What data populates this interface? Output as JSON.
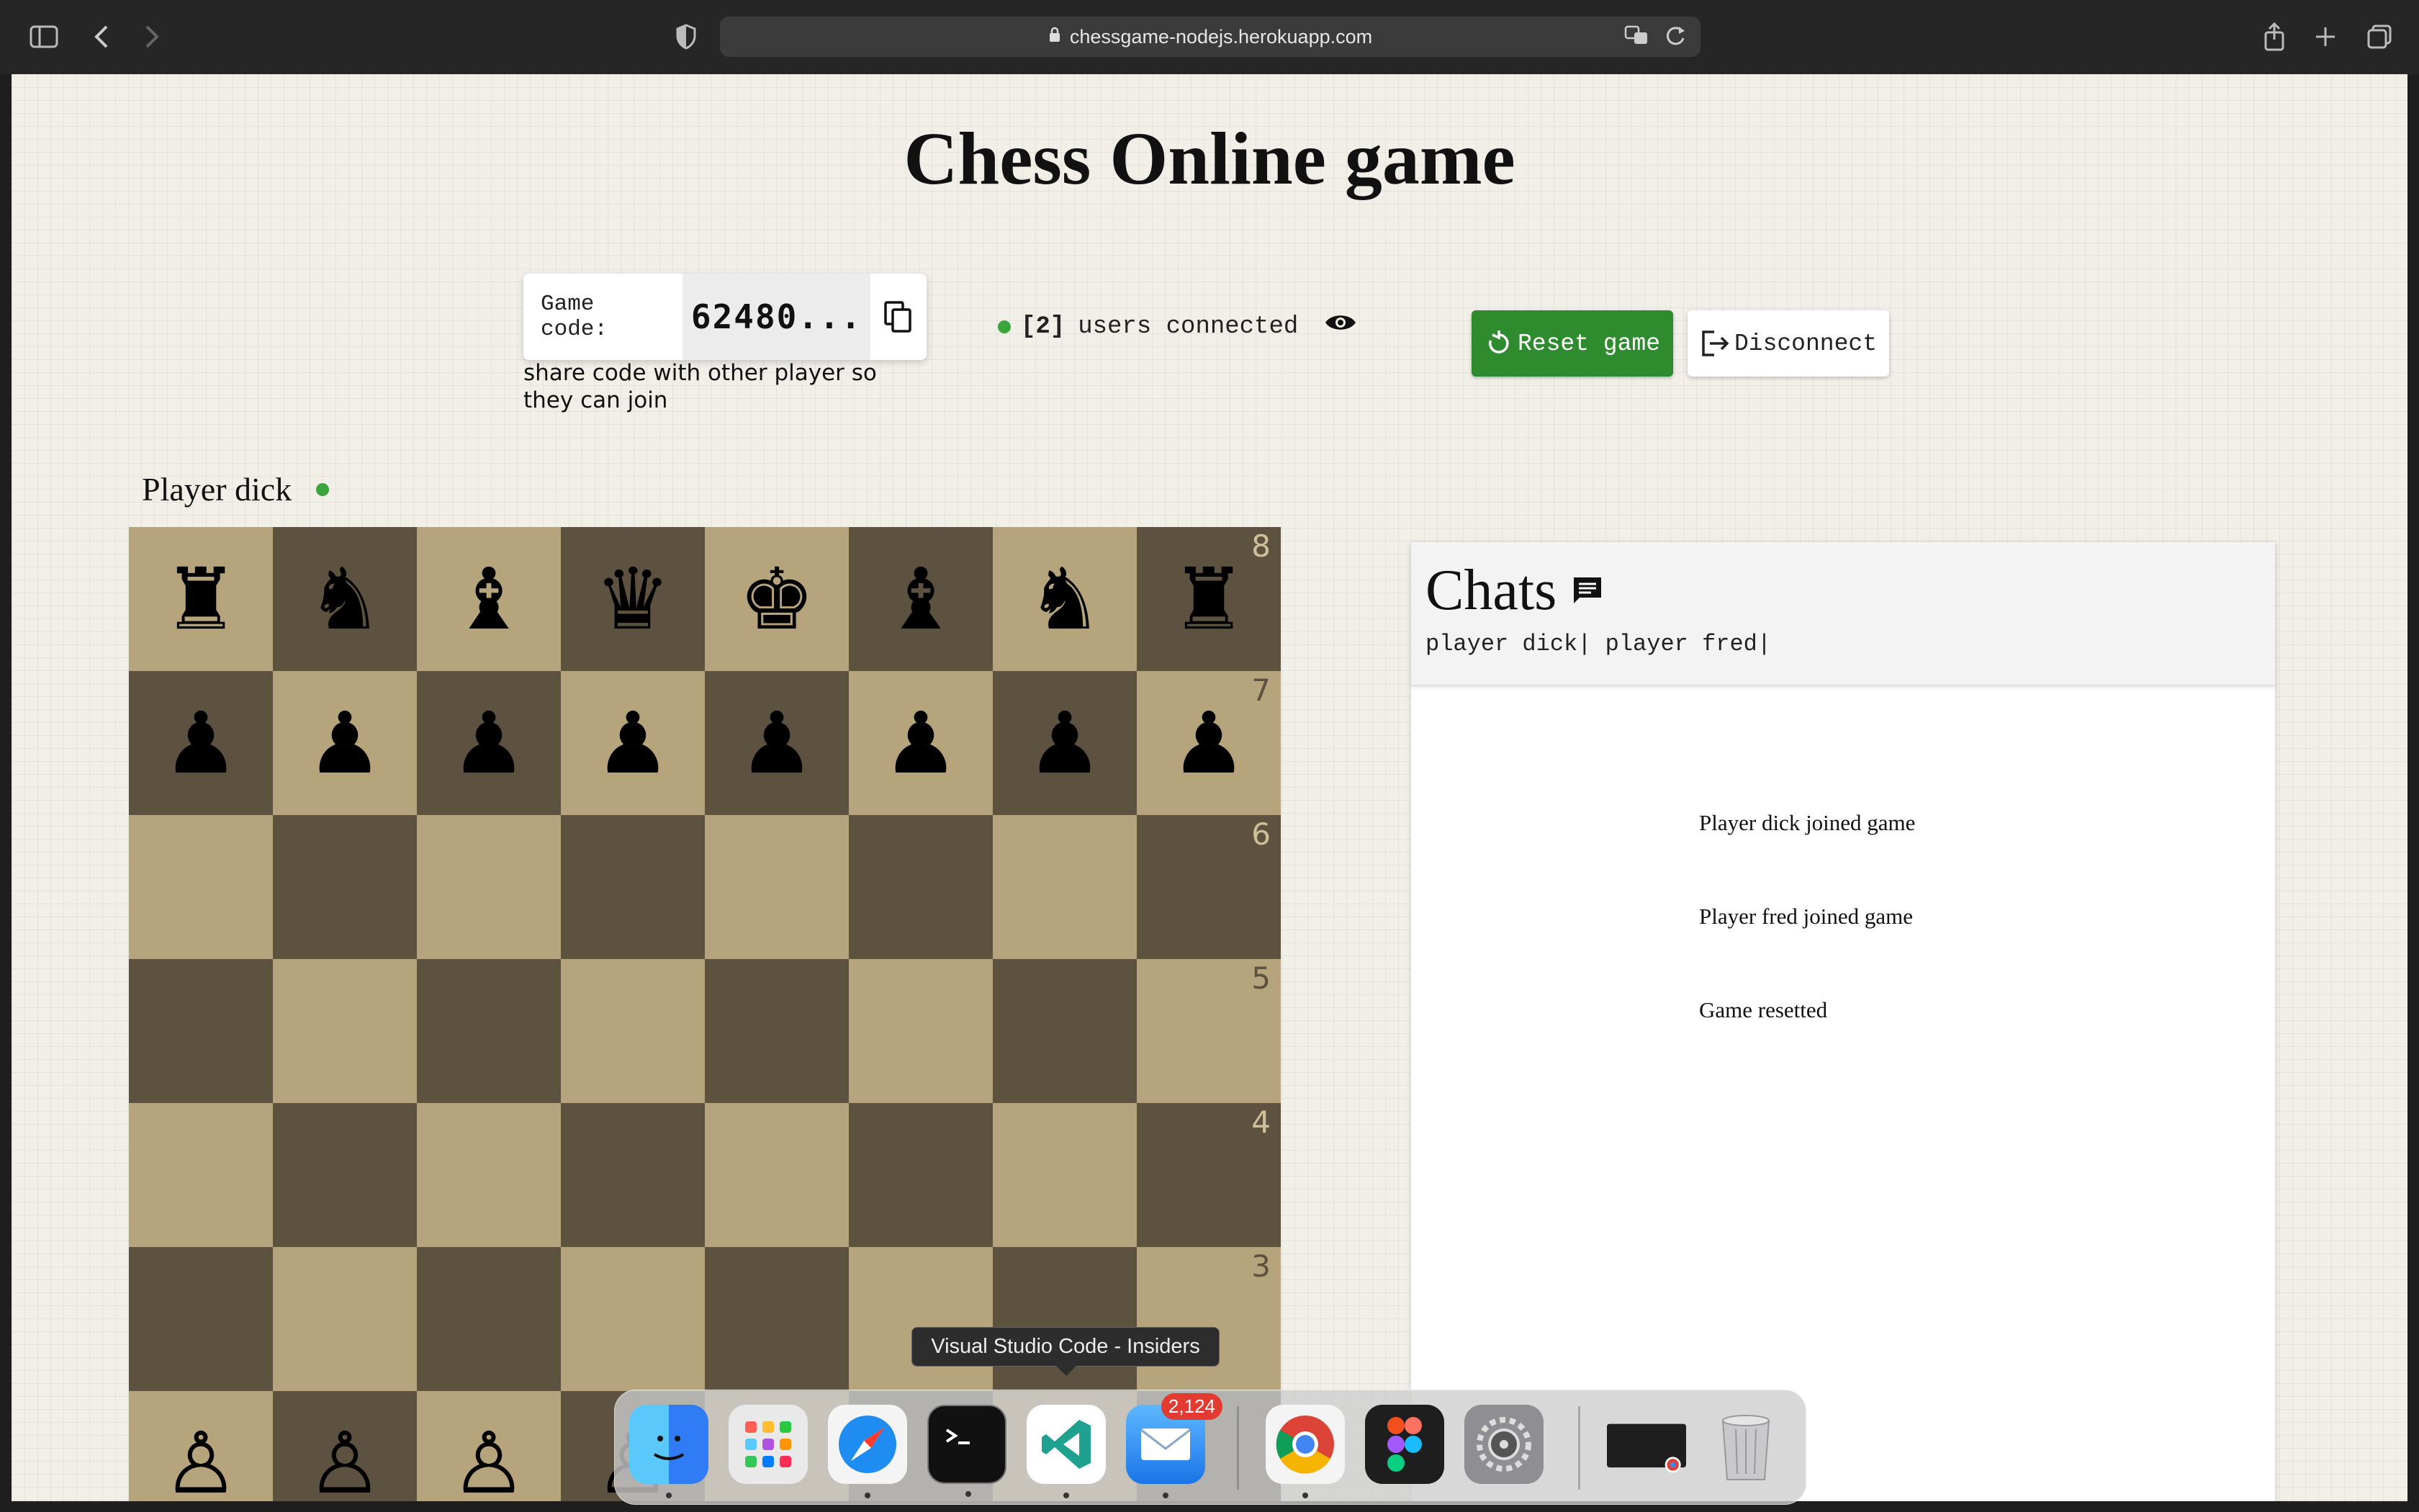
{
  "browser": {
    "url": "chessgame-nodejs.herokuapp.com"
  },
  "page": {
    "title": "Chess Online game"
  },
  "game_code": {
    "label": "Game code:",
    "value": "62480...",
    "hint": "share code with other player so they can join"
  },
  "users": {
    "count": "[2]",
    "text": "users connected"
  },
  "buttons": {
    "reset": "Reset game",
    "disconnect": "Disconnect"
  },
  "player": {
    "label": "Player dick"
  },
  "board": {
    "ranks": [
      {
        "rank": "8",
        "pieces": [
          "♜",
          "♞",
          "♝",
          "♛",
          "♚",
          "♝",
          "♞",
          "♜"
        ]
      },
      {
        "rank": "7",
        "pieces": [
          "♟",
          "♟",
          "♟",
          "♟",
          "♟",
          "♟",
          "♟",
          "♟"
        ]
      },
      {
        "rank": "6",
        "pieces": [
          "",
          "",
          "",
          "",
          "",
          "",
          "",
          ""
        ]
      },
      {
        "rank": "5",
        "pieces": [
          "",
          "",
          "",
          "",
          "",
          "",
          "",
          ""
        ]
      },
      {
        "rank": "4",
        "pieces": [
          "",
          "",
          "",
          "",
          "",
          "",
          "",
          ""
        ]
      },
      {
        "rank": "3",
        "pieces": [
          "",
          "",
          "",
          "",
          "",
          "",
          "",
          ""
        ]
      },
      {
        "rank": "",
        "pieces": [
          "♙",
          "♙",
          "♙",
          "♙",
          "",
          "",
          "",
          ""
        ]
      }
    ]
  },
  "chat": {
    "title": "Chats",
    "participants": "player dick| player fred|",
    "messages": [
      "Player dick joined game",
      "Player fred joined game",
      "Game resetted"
    ]
  },
  "tooltip": "Visual Studio Code - Insiders",
  "dock": {
    "mail_badge": "2,124"
  },
  "colors": {
    "light_square": "#b6a57c",
    "dark_square": "#5d5240",
    "status_green": "#3aa53a",
    "reset_green": "#2e8b2e"
  }
}
